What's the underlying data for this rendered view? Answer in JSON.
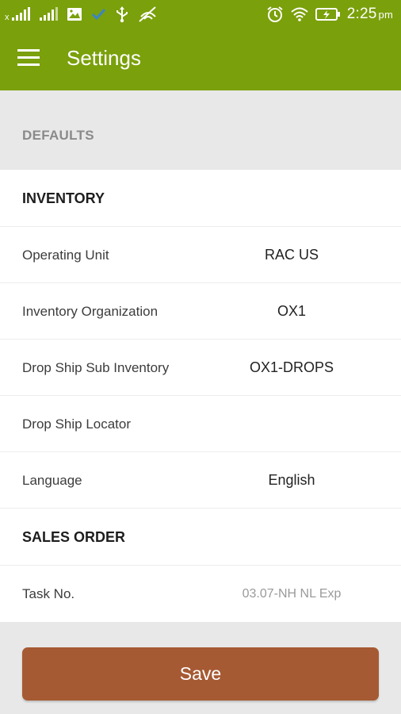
{
  "status_bar": {
    "time": "2:25",
    "ampm": "pm",
    "icons": [
      "signal-x-icon",
      "signal-icon",
      "image-icon",
      "check-icon",
      "usb-icon",
      "no-signal-icon",
      "alarm-icon",
      "wifi-icon",
      "battery-charging-icon"
    ],
    "colors": {
      "background": "#7aa00b"
    }
  },
  "app_bar": {
    "title": "Settings",
    "menu_icon": "hamburger-menu-icon",
    "background": "#7aa00b"
  },
  "section": {
    "label": "DEFAULTS"
  },
  "groups": {
    "inventory": {
      "title": "INVENTORY",
      "fields": {
        "operating_unit": {
          "label": "Operating Unit",
          "value": "RAC US"
        },
        "inventory_org": {
          "label": "Inventory Organization",
          "value": "OX1"
        },
        "drop_ship_sub_inventory": {
          "label": "Drop Ship Sub Inventory",
          "value": "OX1-DROPS"
        },
        "drop_ship_locator": {
          "label": "Drop Ship Locator",
          "value": ""
        },
        "language": {
          "label": "Language",
          "value": "English"
        }
      }
    },
    "sales_order": {
      "title": "SALES ORDER",
      "fields": {
        "task_no": {
          "label": "Task No.",
          "value": "03.07-NH NL Exp"
        }
      }
    }
  },
  "footer": {
    "save_label": "Save",
    "button_color": "#a65a33"
  }
}
